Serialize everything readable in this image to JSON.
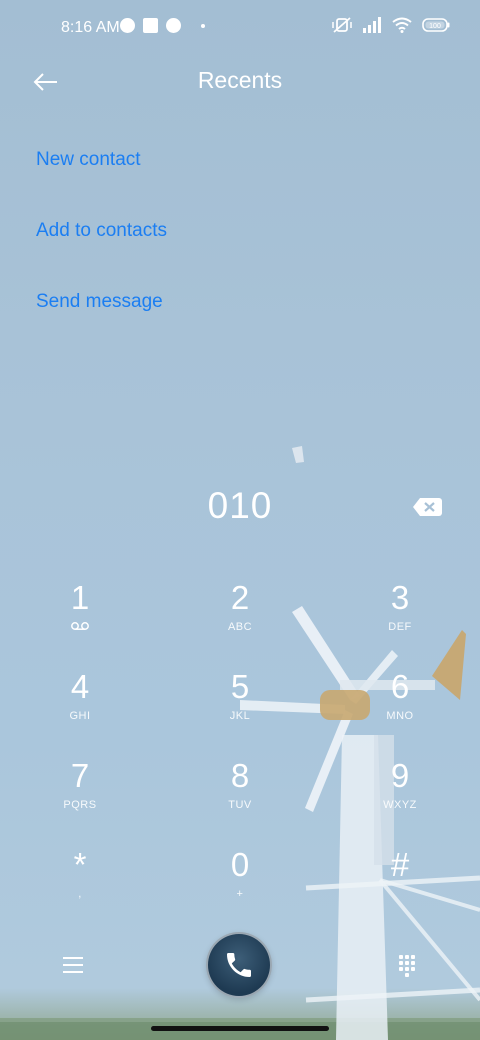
{
  "status_bar": {
    "time": "8:16 AM",
    "left_icons": [
      "notification-round-icon",
      "notification-square-icon",
      "notification-round-icon",
      "dot-icon"
    ],
    "right_icons": [
      "mute-vibrate-icon",
      "signal-icon",
      "wifi-icon",
      "battery-icon"
    ],
    "battery_level": "100"
  },
  "header": {
    "back_icon": "arrow-left-icon",
    "title": "Recents"
  },
  "actions": {
    "new_contact": "New contact",
    "add_to_contacts": "Add to contacts",
    "send_message": "Send message",
    "color": "#1b7ef2"
  },
  "dialer": {
    "number": "010",
    "backspace_icon": "backspace-icon"
  },
  "keys": [
    {
      "num": "1",
      "sub": "",
      "icon": "voicemail-icon"
    },
    {
      "num": "2",
      "sub": "ABC"
    },
    {
      "num": "3",
      "sub": "DEF"
    },
    {
      "num": "4",
      "sub": "GHI"
    },
    {
      "num": "5",
      "sub": "JKL"
    },
    {
      "num": "6",
      "sub": "MNO"
    },
    {
      "num": "7",
      "sub": "PQRS"
    },
    {
      "num": "8",
      "sub": "TUV"
    },
    {
      "num": "9",
      "sub": "WXYZ"
    },
    {
      "num": "*",
      "sub": ","
    },
    {
      "num": "0",
      "sub": "+"
    },
    {
      "num": "#",
      "sub": ""
    }
  ],
  "bottom_bar": {
    "menu_icon": "hamburger-menu-icon",
    "call_icon": "phone-call-icon",
    "keypad_icon": "dialpad-icon"
  },
  "colors": {
    "accent": "#1b7ef2",
    "call_button": "#2b4b64"
  }
}
